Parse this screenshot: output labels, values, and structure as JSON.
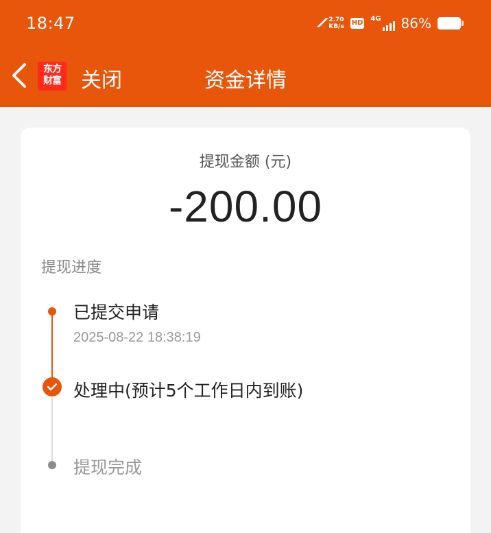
{
  "status_bar": {
    "time": "18:47",
    "carrier_icon": "carrier-logo-icon",
    "net_speed_value": "2.70",
    "net_speed_unit": "KB/s",
    "hd_label": "HD",
    "network_type": "4G",
    "battery_percent": "86%"
  },
  "nav": {
    "back_icon": "chevron-left-icon",
    "logo_line1": "东方",
    "logo_line2": "财富",
    "close_label": "关闭",
    "title": "资金详情"
  },
  "withdrawal": {
    "amount_label": "提现金额 (元)",
    "amount_value": "-200.00",
    "progress_title": "提现进度",
    "steps": [
      {
        "label": "已提交申请",
        "time": "2025-08-22 18:38:19",
        "status": "done"
      },
      {
        "label": "处理中(预计5个工作日内到账)",
        "status": "current"
      },
      {
        "label": "提现完成",
        "status": "pending"
      }
    ]
  },
  "colors": {
    "brand_orange": "#e8560b",
    "logo_red": "#ff2a1a",
    "pending_gray": "#8c8c8c"
  }
}
